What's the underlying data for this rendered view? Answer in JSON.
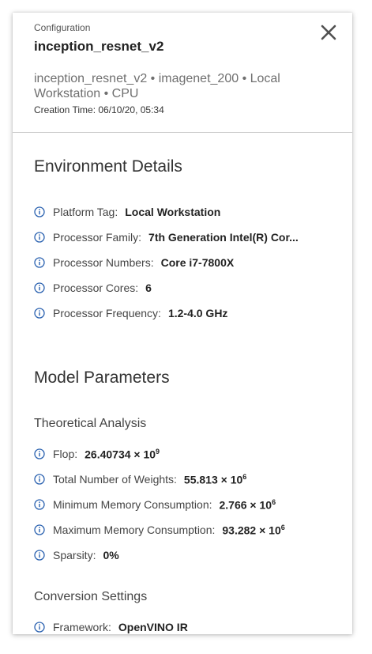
{
  "header": {
    "small_label": "Configuration",
    "title": "inception_resnet_v2",
    "subtitle": "inception_resnet_v2 • imagenet_200 • Local Workstation • CPU",
    "creation_time": "Creation Time: 06/10/20, 05:34",
    "close_icon": "close-icon"
  },
  "environment": {
    "title": "Environment Details",
    "rows": [
      {
        "label": "Platform Tag:",
        "value": "Local Workstation"
      },
      {
        "label": "Processor Family:",
        "value": "7th Generation Intel(R) Cor..."
      },
      {
        "label": "Processor Numbers:",
        "value": "Core i7-7800X"
      },
      {
        "label": "Processor Cores:",
        "value": "6"
      },
      {
        "label": "Processor Frequency:",
        "value": "1.2-4.0 GHz"
      }
    ]
  },
  "model": {
    "title": "Model Parameters",
    "analysis_title": "Theoretical Analysis",
    "rows": [
      {
        "label": "Flop:",
        "mantissa": "26.40734 × 10",
        "exponent": "9"
      },
      {
        "label": "Total Number of Weights:",
        "mantissa": "55.813 × 10",
        "exponent": "6"
      },
      {
        "label": "Minimum Memory Consumption:",
        "mantissa": "2.766 × 10",
        "exponent": "6"
      },
      {
        "label": "Maximum Memory Consumption:",
        "mantissa": "93.282 × 10",
        "exponent": "6"
      },
      {
        "label": "Sparsity:",
        "value": "0%"
      }
    ],
    "conversion_title": "Conversion Settings",
    "conversion_rows": [
      {
        "label": "Framework:",
        "value": "OpenVINO IR"
      }
    ]
  },
  "colors": {
    "info_icon": "#2b62b0",
    "divider": "#cfcfcf"
  }
}
